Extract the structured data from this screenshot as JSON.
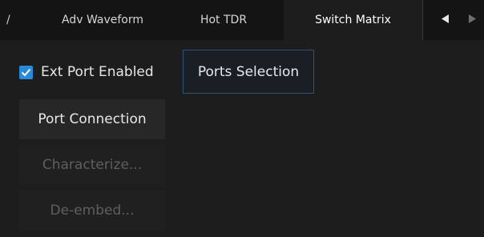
{
  "tabs": {
    "cut_label": "/",
    "items": [
      {
        "label": "Adv Waveform"
      },
      {
        "label": "Hot TDR"
      },
      {
        "label": "Switch Matrix",
        "selected": true
      }
    ],
    "scroll_left_icon": "triangle-left",
    "scroll_right_icon": "triangle-right"
  },
  "panel": {
    "ext_port": {
      "label": "Ext Port Enabled",
      "checked": true
    },
    "ports_selection_label": "Ports Selection",
    "port_connection_label": "Port Connection",
    "characterize_label": "Characterize...",
    "deembed_label": "De-embed..."
  },
  "colors": {
    "background": "#1d1d1d",
    "tabbar": "#141414",
    "accent": "#2a8ad8",
    "disabled_text": "#5f5f5f"
  }
}
